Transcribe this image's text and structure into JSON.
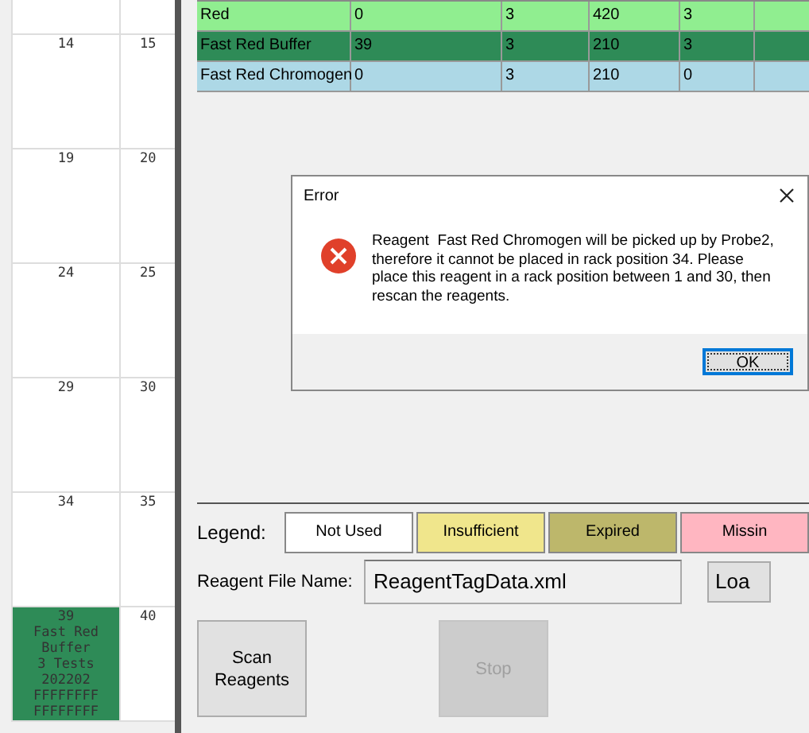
{
  "rack": {
    "rows": [
      [
        {
          "lines": [
            "14"
          ],
          "color": "#ffffff"
        },
        {
          "lines": [
            "15"
          ],
          "color": "#ffffff"
        }
      ],
      [
        {
          "lines": [
            "19"
          ],
          "color": "#ffffff"
        },
        {
          "lines": [
            "20"
          ],
          "color": "#ffffff"
        }
      ],
      [
        {
          "lines": [
            "24"
          ],
          "color": "#ffffff"
        },
        {
          "lines": [
            "25"
          ],
          "color": "#ffffff"
        }
      ],
      [
        {
          "lines": [
            "29"
          ],
          "color": "#ffffff"
        },
        {
          "lines": [
            "30"
          ],
          "color": "#ffffff"
        }
      ],
      [
        {
          "lines": [
            "34"
          ],
          "color": "#ffffff"
        },
        {
          "lines": [
            "35"
          ],
          "color": "#ffffff"
        }
      ],
      [
        {
          "lines": [
            "39",
            "Fast Red",
            "Buffer",
            "3 Tests",
            "202202",
            "FFFFFFFF",
            "FFFFFFFF"
          ],
          "color": "#2e8b57"
        },
        {
          "lines": [
            "40"
          ],
          "color": "#ffffff"
        }
      ]
    ]
  },
  "table": {
    "rows": [
      {
        "cells": [
          "Red",
          "0",
          "3",
          "420",
          "3"
        ],
        "color": "#90ee90"
      },
      {
        "cells": [
          "Fast Red Buffer",
          "39",
          "3",
          "210",
          "3"
        ],
        "color": "#2e8b57"
      },
      {
        "cells": [
          "Fast Red Chromogen",
          "0",
          "3",
          "210",
          "0"
        ],
        "color": "#add8e6"
      }
    ]
  },
  "legend": {
    "label": "Legend:",
    "items": [
      {
        "label": "Not Used",
        "color": "#ffffff"
      },
      {
        "label": "Insufficient",
        "color": "#f0e68c"
      },
      {
        "label": "Expired",
        "color": "#bdb76b"
      },
      {
        "label": "Missin",
        "color": "#ffb6c1"
      }
    ]
  },
  "file": {
    "label": "Reagent File Name:",
    "value": "ReagentTagData.xml",
    "load_button": "Loa"
  },
  "buttons": [
    {
      "label": "Scan Reagents",
      "disabled": false
    },
    {
      "label": "Stop",
      "disabled": true
    }
  ],
  "dialog": {
    "title": "Error",
    "message": "Reagent  Fast Red Chromogen will be picked up by Probe2, therefore it cannot be placed in rack position 34. Please place this reagent in a rack position between 1 and 30, then rescan the reagents.",
    "ok": "OK"
  }
}
